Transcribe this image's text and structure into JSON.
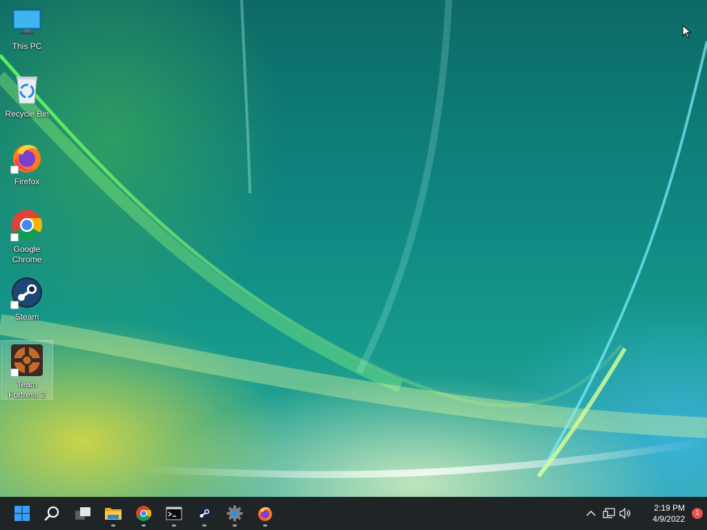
{
  "desktop": {
    "icons": [
      {
        "label": "This PC",
        "icon": "monitor-icon",
        "shortcut": false
      },
      {
        "label": "Recycle Bin",
        "icon": "recycle-bin-icon",
        "shortcut": false
      },
      {
        "label": "Firefox",
        "icon": "firefox-icon",
        "shortcut": true
      },
      {
        "label": "Google Chrome",
        "icon": "chrome-icon",
        "shortcut": true
      },
      {
        "label": "Steam",
        "icon": "steam-icon",
        "shortcut": true
      },
      {
        "label": "Team Fortress 2",
        "icon": "tf2-icon",
        "shortcut": true,
        "selected": true
      }
    ]
  },
  "taskbar": {
    "items": [
      {
        "name": "start-button",
        "icon": "windows-logo-icon"
      },
      {
        "name": "search-button",
        "icon": "search-icon"
      },
      {
        "name": "task-view-button",
        "icon": "task-view-icon"
      },
      {
        "name": "file-explorer-button",
        "icon": "folder-icon",
        "running": true
      },
      {
        "name": "chrome-button",
        "icon": "chrome-icon",
        "running": true
      },
      {
        "name": "terminal-button",
        "icon": "terminal-icon",
        "running": true
      },
      {
        "name": "steam-button",
        "icon": "steam-icon",
        "running": true
      },
      {
        "name": "settings-button",
        "icon": "gear-icon",
        "running": true
      },
      {
        "name": "firefox-button",
        "icon": "firefox-icon",
        "running": true
      }
    ],
    "tray": {
      "time": "2:19 PM",
      "date": "4/9/2022",
      "notification_count": "1",
      "icons": [
        "chevron-up-icon",
        "network-icon",
        "volume-icon"
      ]
    }
  },
  "colors": {
    "taskbar_bg": "#1f2426",
    "accent": "#0078d4",
    "badge": "#e8534d"
  }
}
